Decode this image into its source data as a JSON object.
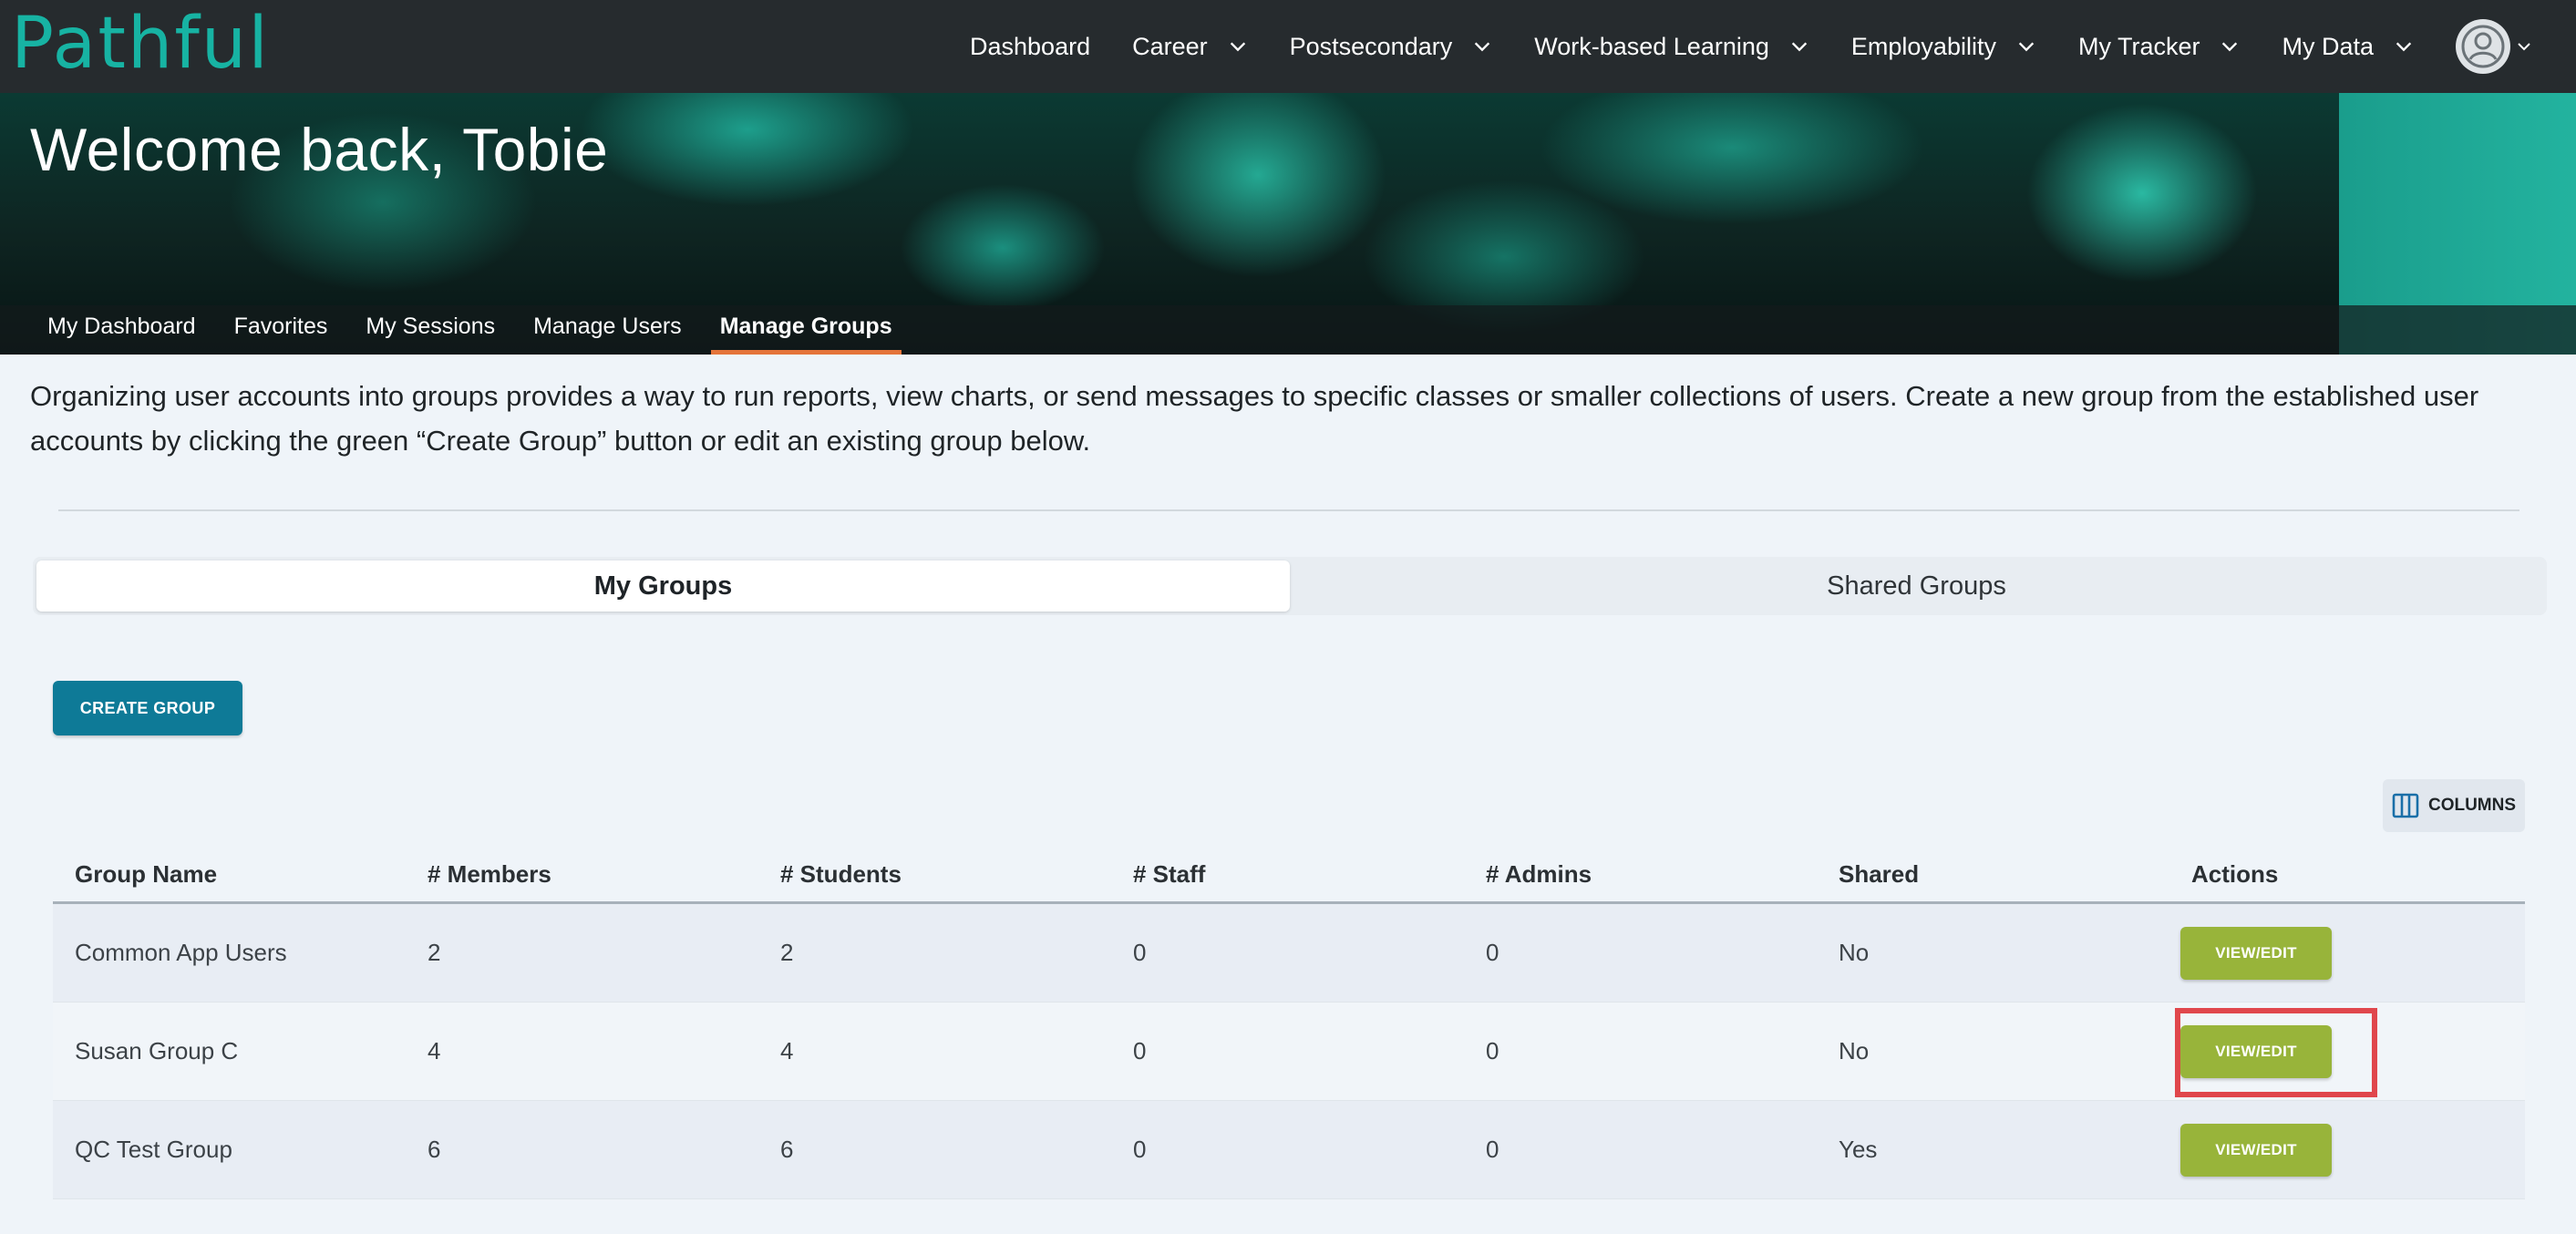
{
  "brand": {
    "logo_text": "Pathful",
    "logo_color": "#17b3a3"
  },
  "topnav": {
    "items": [
      {
        "label": "Dashboard",
        "has_dropdown": false
      },
      {
        "label": "Career",
        "has_dropdown": true
      },
      {
        "label": "Postsecondary",
        "has_dropdown": true
      },
      {
        "label": "Work-based Learning",
        "has_dropdown": true
      },
      {
        "label": "Employability",
        "has_dropdown": true
      },
      {
        "label": "My Tracker",
        "has_dropdown": true
      },
      {
        "label": "My Data",
        "has_dropdown": true
      }
    ],
    "avatar_icon": "user-circle-icon"
  },
  "hero": {
    "title": "Welcome back, Tobie",
    "subnav": [
      {
        "label": "My Dashboard",
        "active": false
      },
      {
        "label": "Favorites",
        "active": false
      },
      {
        "label": "My Sessions",
        "active": false
      },
      {
        "label": "Manage Users",
        "active": false
      },
      {
        "label": "Manage Groups",
        "active": true
      }
    ]
  },
  "intro_text": "Organizing user accounts into groups provides a way to run reports, view charts, or send messages to specific classes or smaller collections of users. Create a new group from the established user accounts by clicking the green “Create Group” button or edit an existing group below.",
  "tabs": [
    {
      "label": "My Groups",
      "active": true
    },
    {
      "label": "Shared Groups",
      "active": false
    }
  ],
  "create_button": "CREATE GROUP",
  "columns_button": "COLUMNS",
  "table": {
    "headers": [
      "Group Name",
      "# Members",
      "# Students",
      "# Staff",
      "# Admins",
      "Shared",
      "Actions"
    ],
    "rows": [
      {
        "name": "Common App Users",
        "members": "2",
        "students": "2",
        "staff": "0",
        "admins": "0",
        "shared": "No",
        "action": "VIEW/EDIT"
      },
      {
        "name": "Susan Group C",
        "members": "4",
        "students": "4",
        "staff": "0",
        "admins": "0",
        "shared": "No",
        "action": "VIEW/EDIT"
      },
      {
        "name": "QC Test Group",
        "members": "6",
        "students": "6",
        "staff": "0",
        "admins": "0",
        "shared": "Yes",
        "action": "VIEW/EDIT"
      }
    ]
  },
  "colors": {
    "nav_bg": "#262b2e",
    "create_button": "#0e7a97",
    "view_edit_button": "#98b43a",
    "active_tab_underline": "#e4743a",
    "highlight_box": "#e0474c"
  }
}
